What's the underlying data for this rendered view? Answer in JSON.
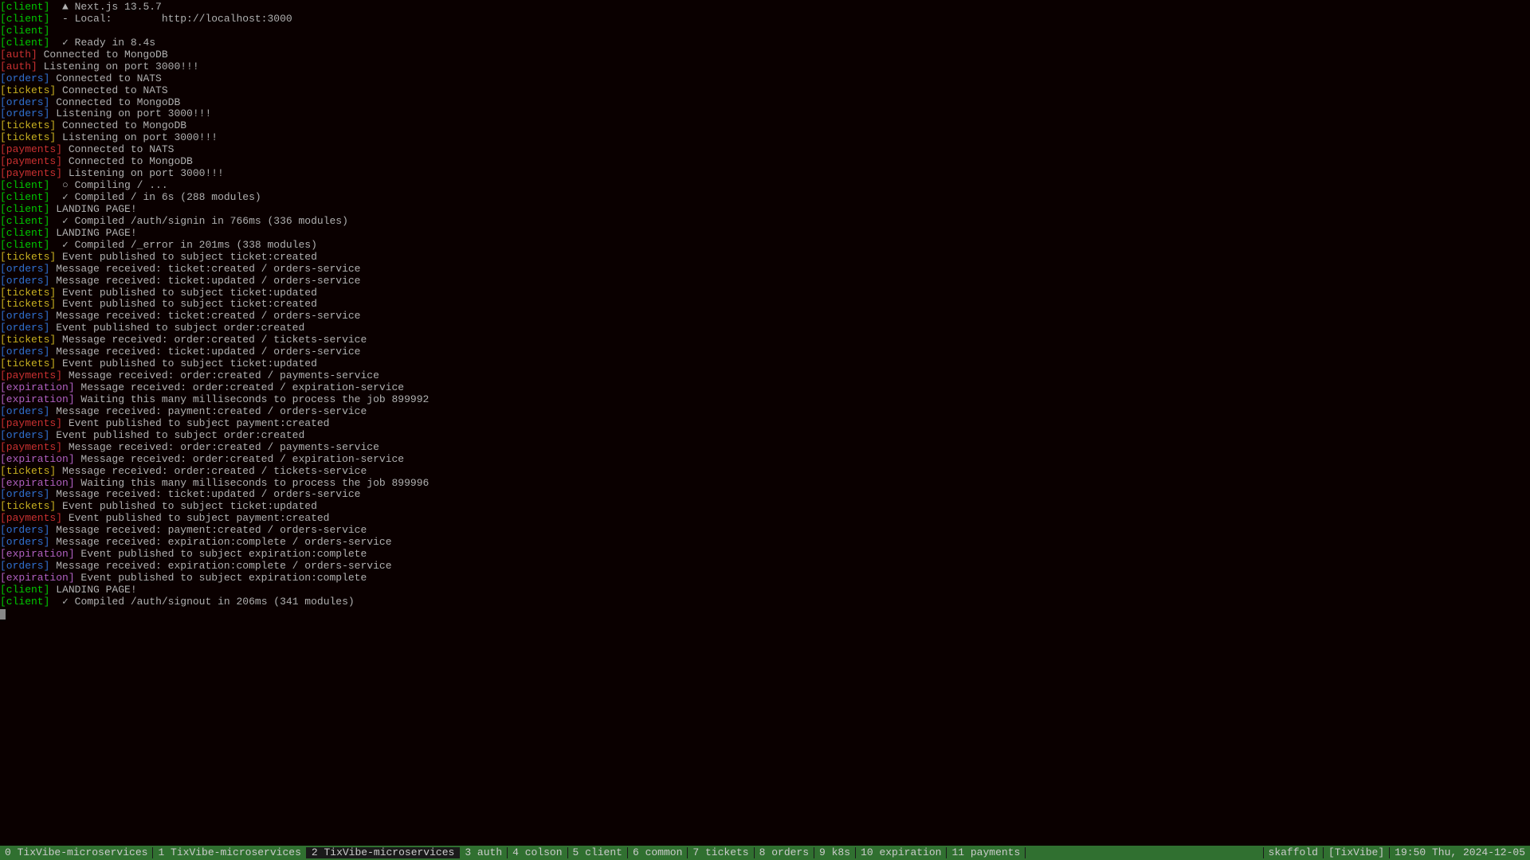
{
  "lines": [
    {
      "tag": "client",
      "msg": "  ▲ Next.js 13.5.7"
    },
    {
      "tag": "client",
      "msg": "  - Local:        http://localhost:3000"
    },
    {
      "tag": "client",
      "msg": ""
    },
    {
      "tag": "client",
      "msg": "  ✓ Ready in 8.4s"
    },
    {
      "tag": "auth",
      "msg": " Connected to MongoDB"
    },
    {
      "tag": "auth",
      "msg": " Listening on port 3000!!!"
    },
    {
      "tag": "orders",
      "msg": " Connected to NATS"
    },
    {
      "tag": "tickets",
      "msg": " Connected to NATS"
    },
    {
      "tag": "orders",
      "msg": " Connected to MongoDB"
    },
    {
      "tag": "orders",
      "msg": " Listening on port 3000!!!"
    },
    {
      "tag": "tickets",
      "msg": " Connected to MongoDB"
    },
    {
      "tag": "tickets",
      "msg": " Listening on port 3000!!!"
    },
    {
      "tag": "payments",
      "msg": " Connected to NATS"
    },
    {
      "tag": "payments",
      "msg": " Connected to MongoDB"
    },
    {
      "tag": "payments",
      "msg": " Listening on port 3000!!!"
    },
    {
      "tag": "client",
      "msg": "  ○ Compiling / ..."
    },
    {
      "tag": "client",
      "msg": "  ✓ Compiled / in 6s (288 modules)"
    },
    {
      "tag": "client",
      "msg": " LANDING PAGE!"
    },
    {
      "tag": "client",
      "msg": "  ✓ Compiled /auth/signin in 766ms (336 modules)"
    },
    {
      "tag": "client",
      "msg": " LANDING PAGE!"
    },
    {
      "tag": "client",
      "msg": "  ✓ Compiled /_error in 201ms (338 modules)"
    },
    {
      "tag": "tickets",
      "msg": " Event published to subject ticket:created"
    },
    {
      "tag": "orders",
      "msg": " Message received: ticket:created / orders-service"
    },
    {
      "tag": "orders",
      "msg": " Message received: ticket:updated / orders-service"
    },
    {
      "tag": "tickets",
      "msg": " Event published to subject ticket:updated"
    },
    {
      "tag": "tickets",
      "msg": " Event published to subject ticket:created"
    },
    {
      "tag": "orders",
      "msg": " Message received: ticket:created / orders-service"
    },
    {
      "tag": "orders",
      "msg": " Event published to subject order:created"
    },
    {
      "tag": "tickets",
      "msg": " Message received: order:created / tickets-service"
    },
    {
      "tag": "orders",
      "msg": " Message received: ticket:updated / orders-service"
    },
    {
      "tag": "tickets",
      "msg": " Event published to subject ticket:updated"
    },
    {
      "tag": "payments",
      "msg": " Message received: order:created / payments-service"
    },
    {
      "tag": "expiration",
      "msg": " Message received: order:created / expiration-service"
    },
    {
      "tag": "expiration",
      "msg": " Waiting this many milliseconds to process the job 899992"
    },
    {
      "tag": "orders",
      "msg": " Message received: payment:created / orders-service"
    },
    {
      "tag": "payments",
      "msg": " Event published to subject payment:created"
    },
    {
      "tag": "orders",
      "msg": " Event published to subject order:created"
    },
    {
      "tag": "payments",
      "msg": " Message received: order:created / payments-service"
    },
    {
      "tag": "expiration",
      "msg": " Message received: order:created / expiration-service"
    },
    {
      "tag": "tickets",
      "msg": " Message received: order:created / tickets-service"
    },
    {
      "tag": "expiration",
      "msg": " Waiting this many milliseconds to process the job 899996"
    },
    {
      "tag": "orders",
      "msg": " Message received: ticket:updated / orders-service"
    },
    {
      "tag": "tickets",
      "msg": " Event published to subject ticket:updated"
    },
    {
      "tag": "payments",
      "msg": " Event published to subject payment:created"
    },
    {
      "tag": "orders",
      "msg": " Message received: payment:created / orders-service"
    },
    {
      "tag": "orders",
      "msg": " Message received: expiration:complete / orders-service"
    },
    {
      "tag": "expiration",
      "msg": " Event published to subject expiration:complete"
    },
    {
      "tag": "orders",
      "msg": " Message received: expiration:complete / orders-service"
    },
    {
      "tag": "expiration",
      "msg": " Event published to subject expiration:complete"
    },
    {
      "tag": "client",
      "msg": " LANDING PAGE!"
    },
    {
      "tag": "client",
      "msg": "  ✓ Compiled /auth/signout in 206ms (341 modules)"
    }
  ],
  "statusbar": {
    "tabs": [
      {
        "label": "0 TixVibe-microservices",
        "active": false
      },
      {
        "label": "1 TixVibe-microservices",
        "active": false
      },
      {
        "label": "2 TixVibe-microservices",
        "active": true
      },
      {
        "label": "3 auth",
        "active": false
      },
      {
        "label": "4 colson",
        "active": false
      },
      {
        "label": "5 client",
        "active": false
      },
      {
        "label": "6 common",
        "active": false
      },
      {
        "label": "7 tickets",
        "active": false
      },
      {
        "label": "8 orders",
        "active": false
      },
      {
        "label": "9 k8s",
        "active": false
      },
      {
        "label": "10 expiration",
        "active": false
      },
      {
        "label": "11 payments",
        "active": false
      }
    ],
    "right": {
      "context": "skaffold",
      "session": "[TixVibe]",
      "datetime": "19:50 Thu, 2024-12-05"
    }
  }
}
